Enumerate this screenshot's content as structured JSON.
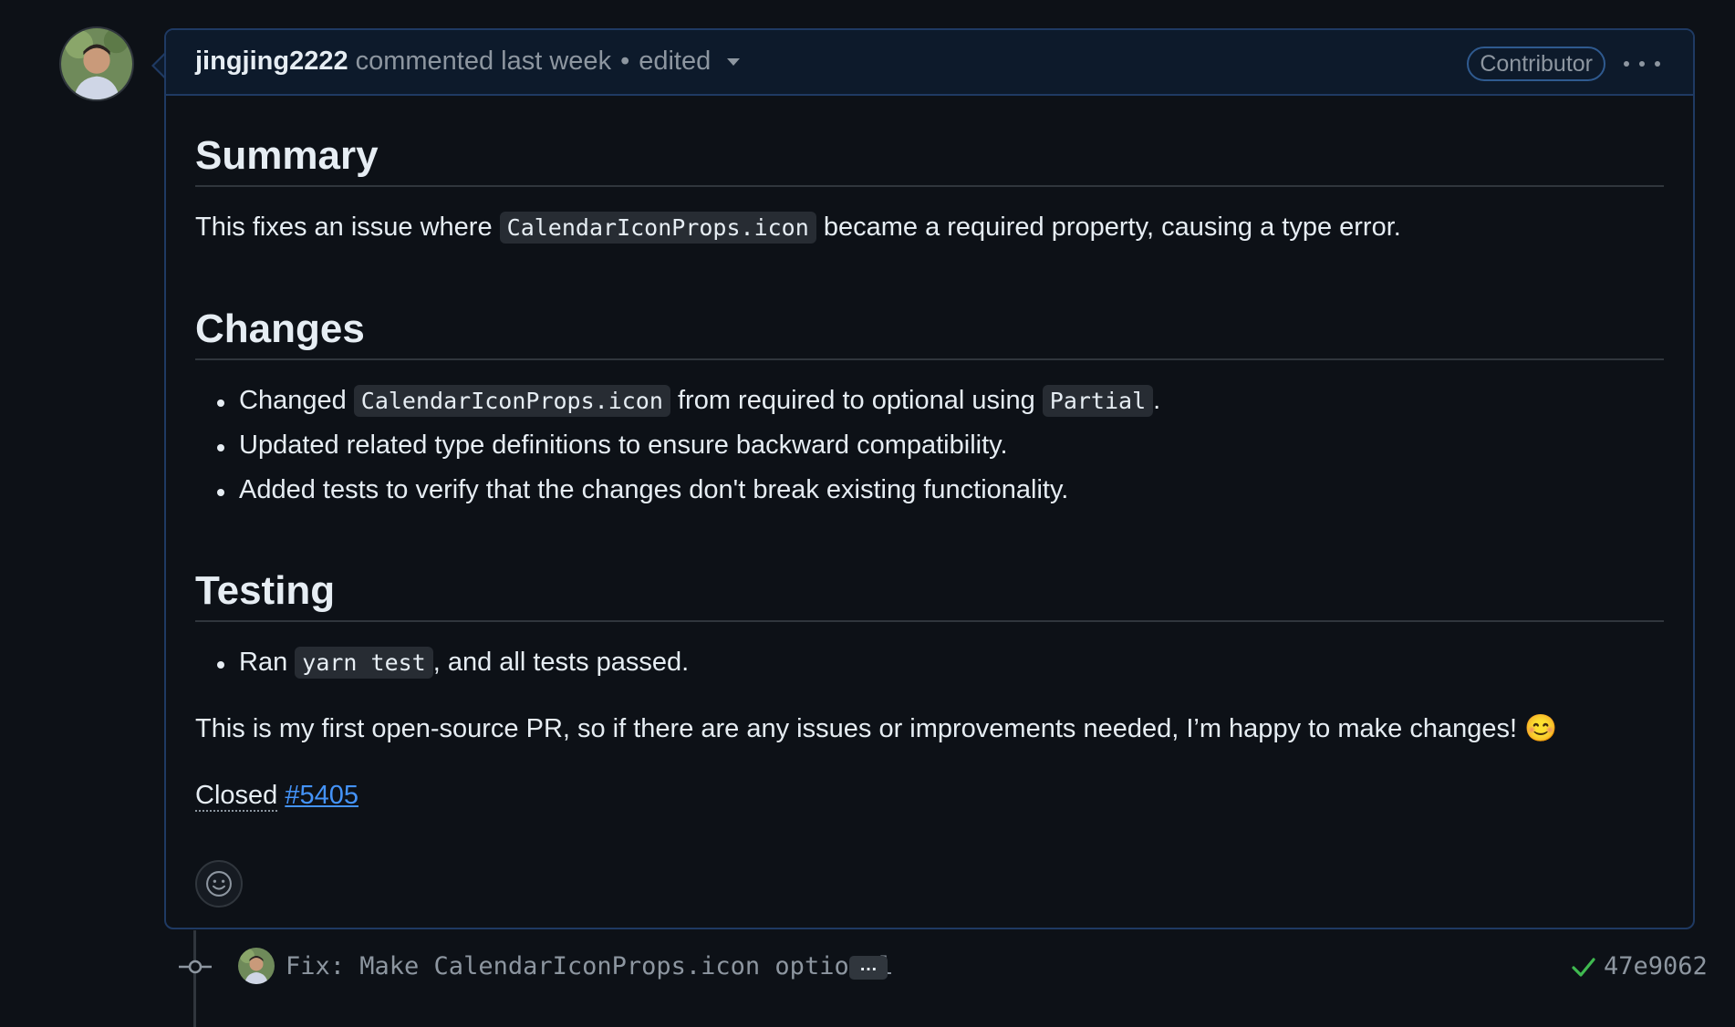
{
  "comment": {
    "author": "jingjing2222",
    "action": "commented last week",
    "separator": "•",
    "edited": "edited",
    "badge": "Contributor"
  },
  "body": {
    "summary_heading": "Summary",
    "summary_prefix": "This fixes an issue where ",
    "summary_code": "CalendarIconProps.icon",
    "summary_suffix": " became a required property, causing a type error.",
    "changes_heading": "Changes",
    "changes": [
      {
        "prefix": "Changed ",
        "code1": "CalendarIconProps.icon",
        "middle": " from required to optional using ",
        "code2": "Partial",
        "suffix": "."
      },
      {
        "text": "Updated related type definitions to ensure backward compatibility."
      },
      {
        "text": "Added tests to verify that the changes don't break existing functionality."
      }
    ],
    "testing_heading": "Testing",
    "testing": [
      {
        "prefix": "Ran ",
        "code": "yarn test",
        "suffix": ", and all tests passed."
      }
    ],
    "closing_text": "This is my first open-source PR, so if there are any issues or improvements needed, I’m happy to make changes! 😊",
    "closed_label": "Closed",
    "closed_issue": "#5405"
  },
  "timeline": {
    "commit_message": "Fix: Make CalendarIconProps.icon optional",
    "ellipsis": "…",
    "sha": "47e9062"
  },
  "colors": {
    "background": "#0d1117",
    "header_bg": "#0d1a2b",
    "border_accent": "#1f3a63",
    "link": "#4493f8",
    "success": "#3fb950"
  },
  "icons": [
    "avatar",
    "chevron-down-icon",
    "kebab-icon",
    "smiley-icon",
    "git-commit-icon",
    "check-icon"
  ]
}
